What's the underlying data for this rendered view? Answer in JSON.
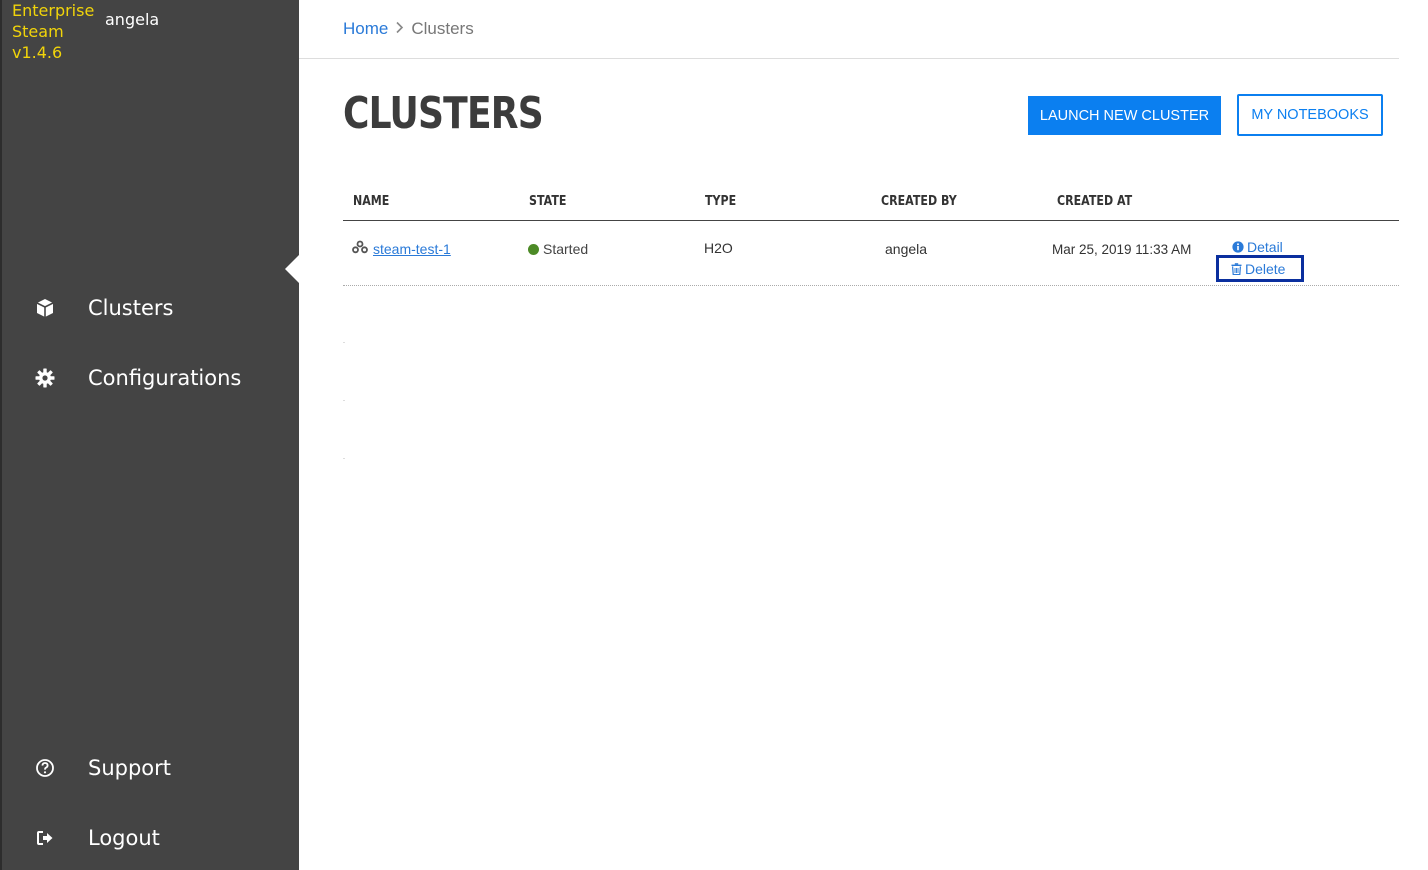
{
  "sidebar": {
    "brand": [
      "Enterprise",
      "Steam",
      "v1.4.6"
    ],
    "user": "angela",
    "items": [
      {
        "label": "Clusters",
        "icon": "cube-icon"
      },
      {
        "label": "Configurations",
        "icon": "gear-icon"
      },
      {
        "label": "Support",
        "icon": "help-circle-icon"
      },
      {
        "label": "Logout",
        "icon": "logout-icon"
      }
    ]
  },
  "breadcrumb": {
    "home": "Home",
    "current": "Clusters"
  },
  "page": {
    "title": "CLUSTERS",
    "launch_label": "LAUNCH NEW CLUSTER",
    "notebooks_label": "MY NOTEBOOKS"
  },
  "table": {
    "headers": [
      "NAME",
      "STATE",
      "TYPE",
      "CREATED BY",
      "CREATED AT"
    ],
    "rows": [
      {
        "name": "steam-test-1",
        "state": "Started",
        "type": "H2O",
        "created_by": "angela",
        "created_at": "Mar 25, 2019 11:33 AM",
        "actions": {
          "detail": "Detail",
          "delete": "Delete"
        }
      }
    ]
  },
  "colors": {
    "brand_yellow": "#f1d40a",
    "accent_blue": "#0b7ff0",
    "link_blue": "#2a7ad8",
    "status_started": "#4c8a26",
    "sidebar_bg": "#444444",
    "highlight_box": "#0a2f9e"
  }
}
